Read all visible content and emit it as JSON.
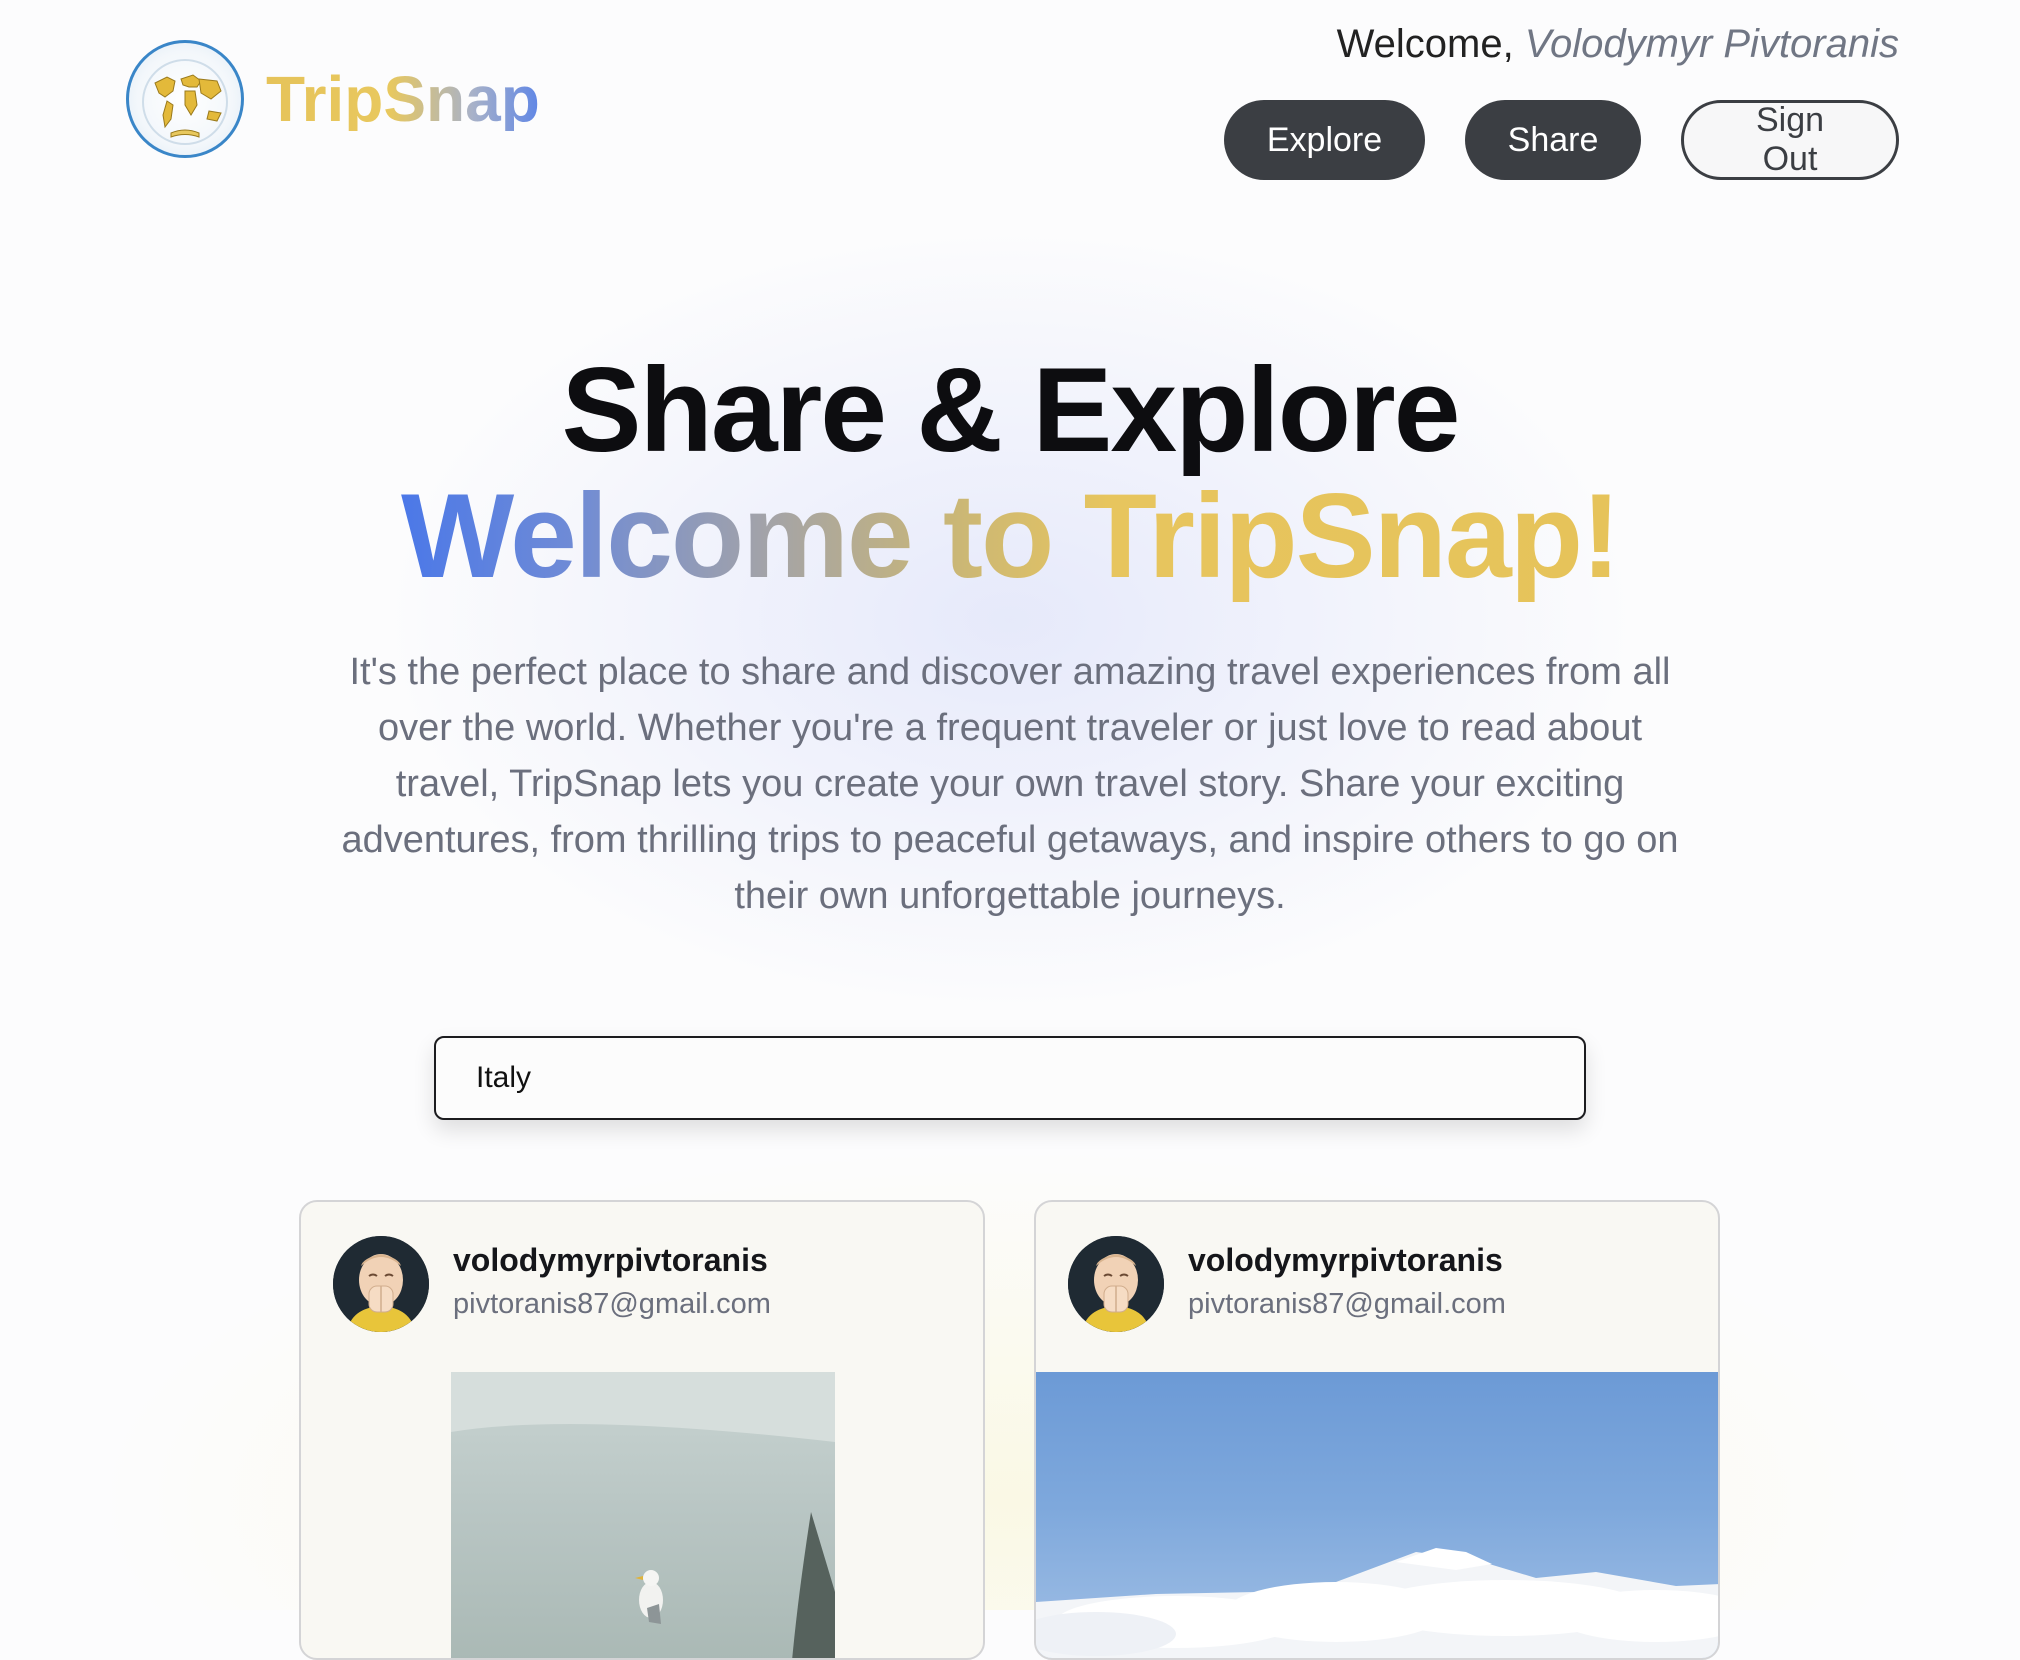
{
  "brand": {
    "name": "TripSnap",
    "logo_icon": "world-map-globe-icon"
  },
  "header": {
    "welcome_prefix": "Welcome, ",
    "user_name": "Volodymyr Pivtoranis",
    "buttons": {
      "explore": "Explore",
      "share": "Share",
      "sign_out": "Sign Out"
    }
  },
  "hero": {
    "title": "Share & Explore",
    "subtitle": "Welcome to TripSnap!",
    "description": "It's the perfect place to share and discover amazing travel experiences from all over the world. Whether you're a frequent traveler or just love to read about travel, TripSnap lets you create your own travel story. Share your exciting adventures, from thrilling trips to peaceful getaways, and inspire others to go on their own unforgettable journeys."
  },
  "search": {
    "value": "Italy"
  },
  "posts": [
    {
      "username": "volodymyrpivtoranis",
      "email": "pivtoranis87@gmail.com",
      "avatar_icon": "memoji-avatar",
      "image": "coastal-seagull-photo"
    },
    {
      "username": "volodymyrpivtoranis",
      "email": "pivtoranis87@gmail.com",
      "avatar_icon": "memoji-avatar",
      "image": "mountain-above-clouds-photo"
    }
  ],
  "colors": {
    "brand_gold": "#e6c35a",
    "brand_blue": "#4b78e8",
    "button_dark": "#3b3e43",
    "text_muted": "#6b6f7d"
  }
}
